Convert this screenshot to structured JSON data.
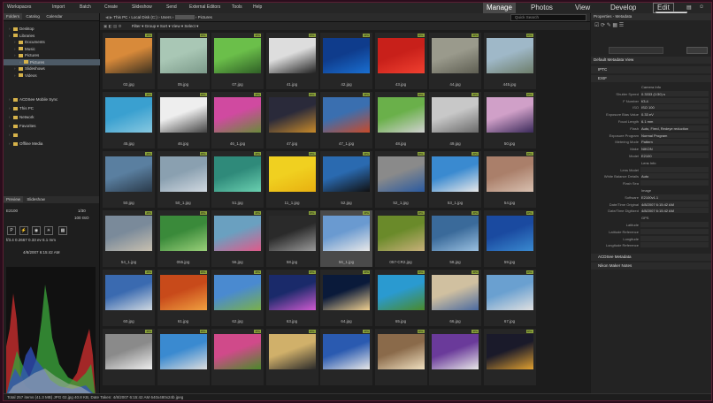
{
  "menu": [
    "Workspaces",
    "Import",
    "Batch",
    "Create",
    "Slideshow",
    "Send",
    "External Editors",
    "Tools",
    "Help"
  ],
  "modes": [
    {
      "label": "Manage",
      "active": true
    },
    {
      "label": "Photos",
      "active": false
    },
    {
      "label": "View",
      "active": false
    },
    {
      "label": "Develop",
      "active": false
    },
    {
      "label": "Edit",
      "active": false
    }
  ],
  "tooltip": "Edit (Ctrl+F5)",
  "left_tabs": [
    "Folders",
    "Catalog",
    "Calendar"
  ],
  "tree": [
    {
      "label": "Desktop",
      "indent": 1,
      "sel": false
    },
    {
      "label": "Libraries",
      "indent": 1,
      "sel": false
    },
    {
      "label": "Documents",
      "indent": 2,
      "sel": false
    },
    {
      "label": "Music",
      "indent": 2,
      "sel": false
    },
    {
      "label": "Pictures",
      "indent": 2,
      "sel": false
    },
    {
      "label": "Pictures",
      "indent": 3,
      "sel": true
    },
    {
      "label": "Slideshows",
      "indent": 2,
      "sel": false
    },
    {
      "label": "Videos",
      "indent": 2,
      "sel": false
    },
    {
      "label": "ACDSee Mobile Sync",
      "indent": 1,
      "sel": false
    },
    {
      "label": "This PC",
      "indent": 1,
      "sel": false
    },
    {
      "label": "Network",
      "indent": 1,
      "sel": false
    },
    {
      "label": "Favorites",
      "indent": 1,
      "sel": false
    },
    {
      "label": "",
      "indent": 1,
      "sel": false
    },
    {
      "label": "Offline Media",
      "indent": 1,
      "sel": false
    }
  ],
  "preview": {
    "tabs": [
      "Preview",
      "Slideshow"
    ],
    "camera": "E2100",
    "v1": "1/30",
    "v2": "100 ISO",
    "mode": "P",
    "exif": "f/3.4   0.2667   0.33 ev   6.1 mm",
    "date": "4/8/2007 6:15:42 AM"
  },
  "path": [
    "This PC",
    "Local Disk (C:)",
    "Users",
    "",
    "Pictures"
  ],
  "search_placeholder": "Quick Search",
  "toolbar": [
    "Filter",
    "Group",
    "Sort",
    "View",
    "Select"
  ],
  "rows": [
    [
      {
        "cap": "02.jpg"
      },
      {
        "cap": "05.jpg"
      },
      {
        "cap": "07.jpg"
      },
      {
        "cap": "41.jpg"
      },
      {
        "cap": "42.jpg"
      },
      {
        "cap": "43.jpg"
      },
      {
        "cap": "44.jpg"
      },
      {
        "cap": "445.jpg"
      }
    ],
    [
      {
        "cap": "45.jpg"
      },
      {
        "cap": "46.jpg"
      },
      {
        "cap": "46_1.jpg"
      },
      {
        "cap": "47.jpg"
      },
      {
        "cap": "47_1.jpg"
      },
      {
        "cap": "48.jpg"
      },
      {
        "cap": "49.jpg"
      },
      {
        "cap": "50.jpg"
      }
    ],
    [
      {
        "cap": "50.jpg"
      },
      {
        "cap": "50_1.jpg"
      },
      {
        "cap": "51.jpg"
      },
      {
        "cap": "11_1.jpg"
      },
      {
        "cap": "52.jpg"
      },
      {
        "cap": "52_1.jpg"
      },
      {
        "cap": "53_1.jpg"
      },
      {
        "cap": "54.jpg"
      }
    ],
    [
      {
        "cap": "54_1.jpg"
      },
      {
        "cap": "055.jpg"
      },
      {
        "cap": "56.jpg"
      },
      {
        "cap": "58.jpg"
      },
      {
        "cap": "56_1.jpg"
      },
      {
        "cap": "057-CR2.jpg"
      },
      {
        "cap": "58.jpg"
      },
      {
        "cap": "59.jpg"
      }
    ],
    [
      {
        "cap": "60.jpg"
      },
      {
        "cap": "61.jpg"
      },
      {
        "cap": "62.jpg"
      },
      {
        "cap": "63.jpg"
      },
      {
        "cap": "64.jpg"
      },
      {
        "cap": "65.jpg"
      },
      {
        "cap": "66.jpg"
      },
      {
        "cap": "67.jpg"
      }
    ],
    [
      {
        "cap": ""
      },
      {
        "cap": ""
      },
      {
        "cap": ""
      },
      {
        "cap": ""
      },
      {
        "cap": ""
      },
      {
        "cap": ""
      },
      {
        "cap": ""
      },
      {
        "cap": ""
      }
    ]
  ],
  "badge": "JPG",
  "right": {
    "title": "Properties - Metadata",
    "view": "Default Metadata View",
    "iptc": "IPTC",
    "exif": "EXIF",
    "props": [
      [
        "",
        "Camera Info"
      ],
      [
        "Shutter Speed",
        "0.3333 (1/30) s"
      ],
      [
        "F Number",
        "f/3.4"
      ],
      [
        "ISO",
        "ISO 100"
      ],
      [
        "Exposure Bias Value",
        "0.33 eV"
      ],
      [
        "Focal Length",
        "6.1 mm"
      ],
      [
        "Flash",
        "Auto, Fired, Redeye reduction"
      ],
      [
        "Exposure Program",
        "Normal Program"
      ],
      [
        "Metering Mode",
        "Pattern"
      ],
      [
        "Make",
        "NIKON"
      ],
      [
        "Model",
        "E2100"
      ],
      [
        "",
        "Lens Info"
      ],
      [
        "Lens Model",
        ""
      ],
      [
        "White Balance Details",
        "Auto"
      ],
      [
        "Flash Sea",
        ""
      ],
      [
        "",
        "Image"
      ],
      [
        "Software",
        "E2100v1.1"
      ],
      [
        "Date/Time Original",
        "4/8/2007 6:15:42 AM"
      ],
      [
        "Date/Time Digitized",
        "4/8/2007 6:15:42 AM"
      ],
      [
        "",
        "GPS"
      ],
      [
        "Latitude",
        ""
      ],
      [
        "Latitude Reference",
        ""
      ],
      [
        "Longitude",
        ""
      ],
      [
        "Longitude Reference",
        ""
      ]
    ],
    "acdsee_meta": "ACDSee Metadata",
    "nikon": "Nikon Maker Notes",
    "bottom_tabs": [
      "Metadata",
      "Organize",
      "File"
    ]
  },
  "status": "Total 257 items (41.3 MB)   JPG   02.jpg   40.8 KB, Date Taken: 4/8/2007 6:15:42 AM   640x480x24b jpeg"
}
